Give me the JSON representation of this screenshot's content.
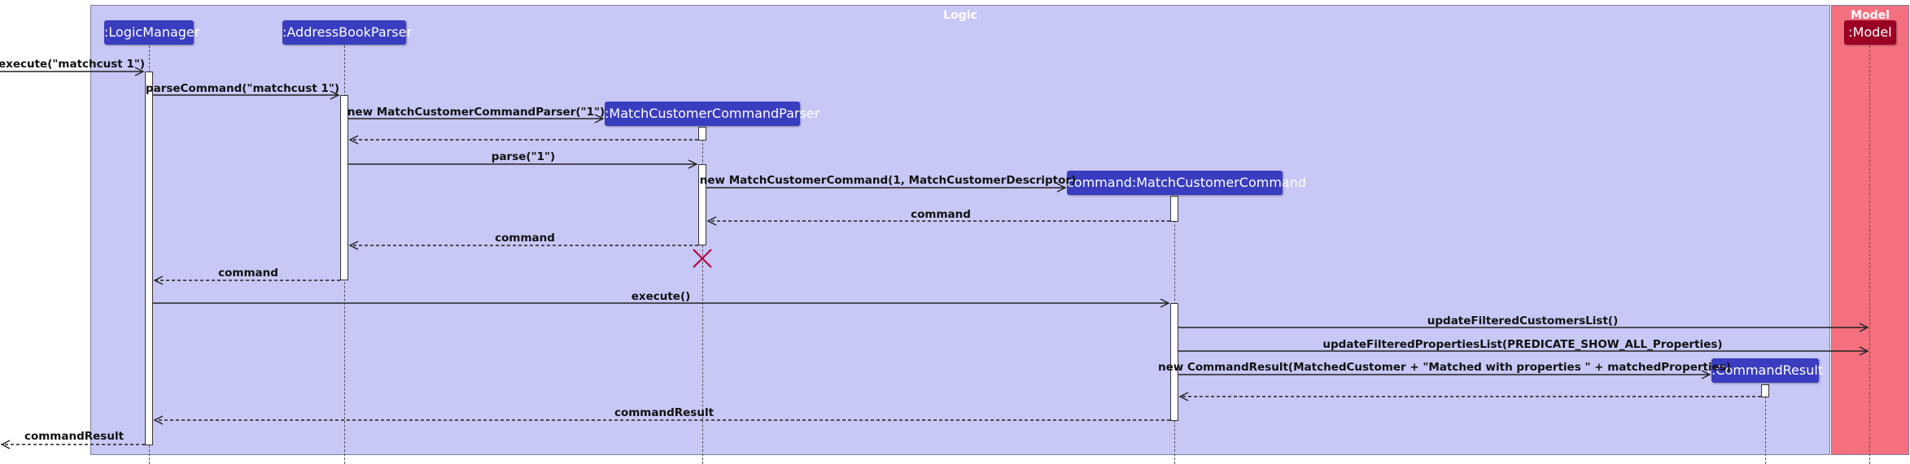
{
  "groups": {
    "logic": {
      "title": "Logic",
      "color": "#c8c8f6"
    },
    "model": {
      "title": "Model",
      "color": "#f4707f"
    }
  },
  "participants": {
    "logic_manager": ":LogicManager",
    "address_book_parser": ":AddressBookParser",
    "match_customer_command_parser": ":MatchCustomerCommandParser",
    "match_customer_command": "command:MatchCustomerCommand",
    "command_result": ":CommandResult",
    "model": ":Model"
  },
  "messages": {
    "m1": "execute(\"matchcust 1\")",
    "m2": "parseCommand(\"matchcust 1\")",
    "m3": "new MatchCustomerCommandParser(\"1\")",
    "m4": "parse(\"1\")",
    "m5": "new MatchCustomerCommand(1, MatchCustomerDescriptor)",
    "m6": "command",
    "m7": "command",
    "m8": "command",
    "m9": "execute()",
    "m10": "updateFilteredCustomersList()",
    "m11": "updateFilteredPropertiesList(PREDICATE_SHOW_ALL_Properties)",
    "m12": "new CommandResult(MatchedCustomer + \"Matched with properties \" + matchedProperties)",
    "m13": "commandResult",
    "m14": "commandResult"
  }
}
